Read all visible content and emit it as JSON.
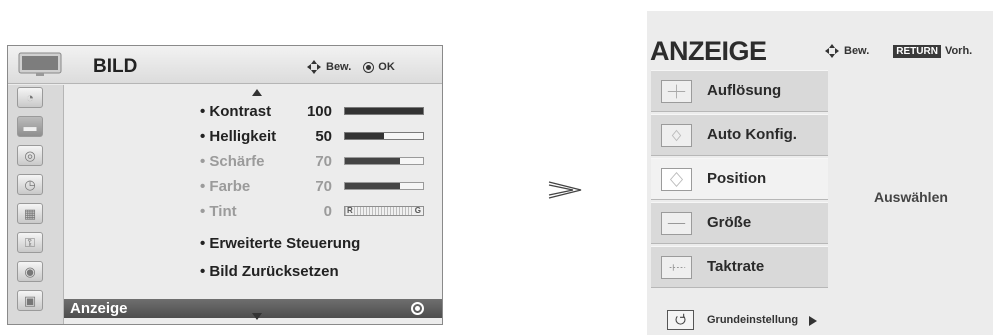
{
  "left_menu": {
    "title": "BILD",
    "hint_move": "Bew.",
    "hint_ok": "OK",
    "categories": [
      {
        "icon": "speaker-icon",
        "glyph": "◔"
      },
      {
        "icon": "tv-icon",
        "glyph": "▬"
      },
      {
        "icon": "disc-icon",
        "glyph": "◎"
      },
      {
        "icon": "clock-icon",
        "glyph": "◷"
      },
      {
        "icon": "calendar-icon",
        "glyph": "▦"
      },
      {
        "icon": "lock-icon",
        "glyph": "⚿"
      },
      {
        "icon": "globe-icon",
        "glyph": "◉"
      },
      {
        "icon": "photo-icon",
        "glyph": "▣"
      }
    ],
    "options": [
      {
        "label": "• Kontrast",
        "value": "100",
        "level": 1.0
      },
      {
        "label": "• Helligkeit",
        "value": "50",
        "level": 0.5
      },
      {
        "label": "• Schärfe",
        "value": "70",
        "level": 0.7
      },
      {
        "label": "• Farbe",
        "value": "70",
        "level": 0.7
      },
      {
        "label": "• Tint",
        "value": "0",
        "bar_left": "R",
        "bar_right": "G"
      },
      {
        "label": "• Erweiterte Steuerung"
      },
      {
        "label": "• Bild Zurücksetzen"
      }
    ],
    "selected_label": "Anzeige"
  },
  "right_menu": {
    "title": "ANZEIGE",
    "hint_move": "Bew.",
    "return_badge": "RETURN",
    "hint_back": "Vorh.",
    "items": [
      {
        "label": "Auflösung"
      },
      {
        "label": "Auto Konfig."
      },
      {
        "label": "Position"
      },
      {
        "label": "Größe"
      },
      {
        "label": "Taktrate"
      }
    ],
    "footer_label": "Grundeinstellung",
    "panel_text": "Auswählen"
  },
  "colors": {
    "panel_bg": "#ececec",
    "highlight": "#555555",
    "dim_text": "#9b9b9b"
  }
}
